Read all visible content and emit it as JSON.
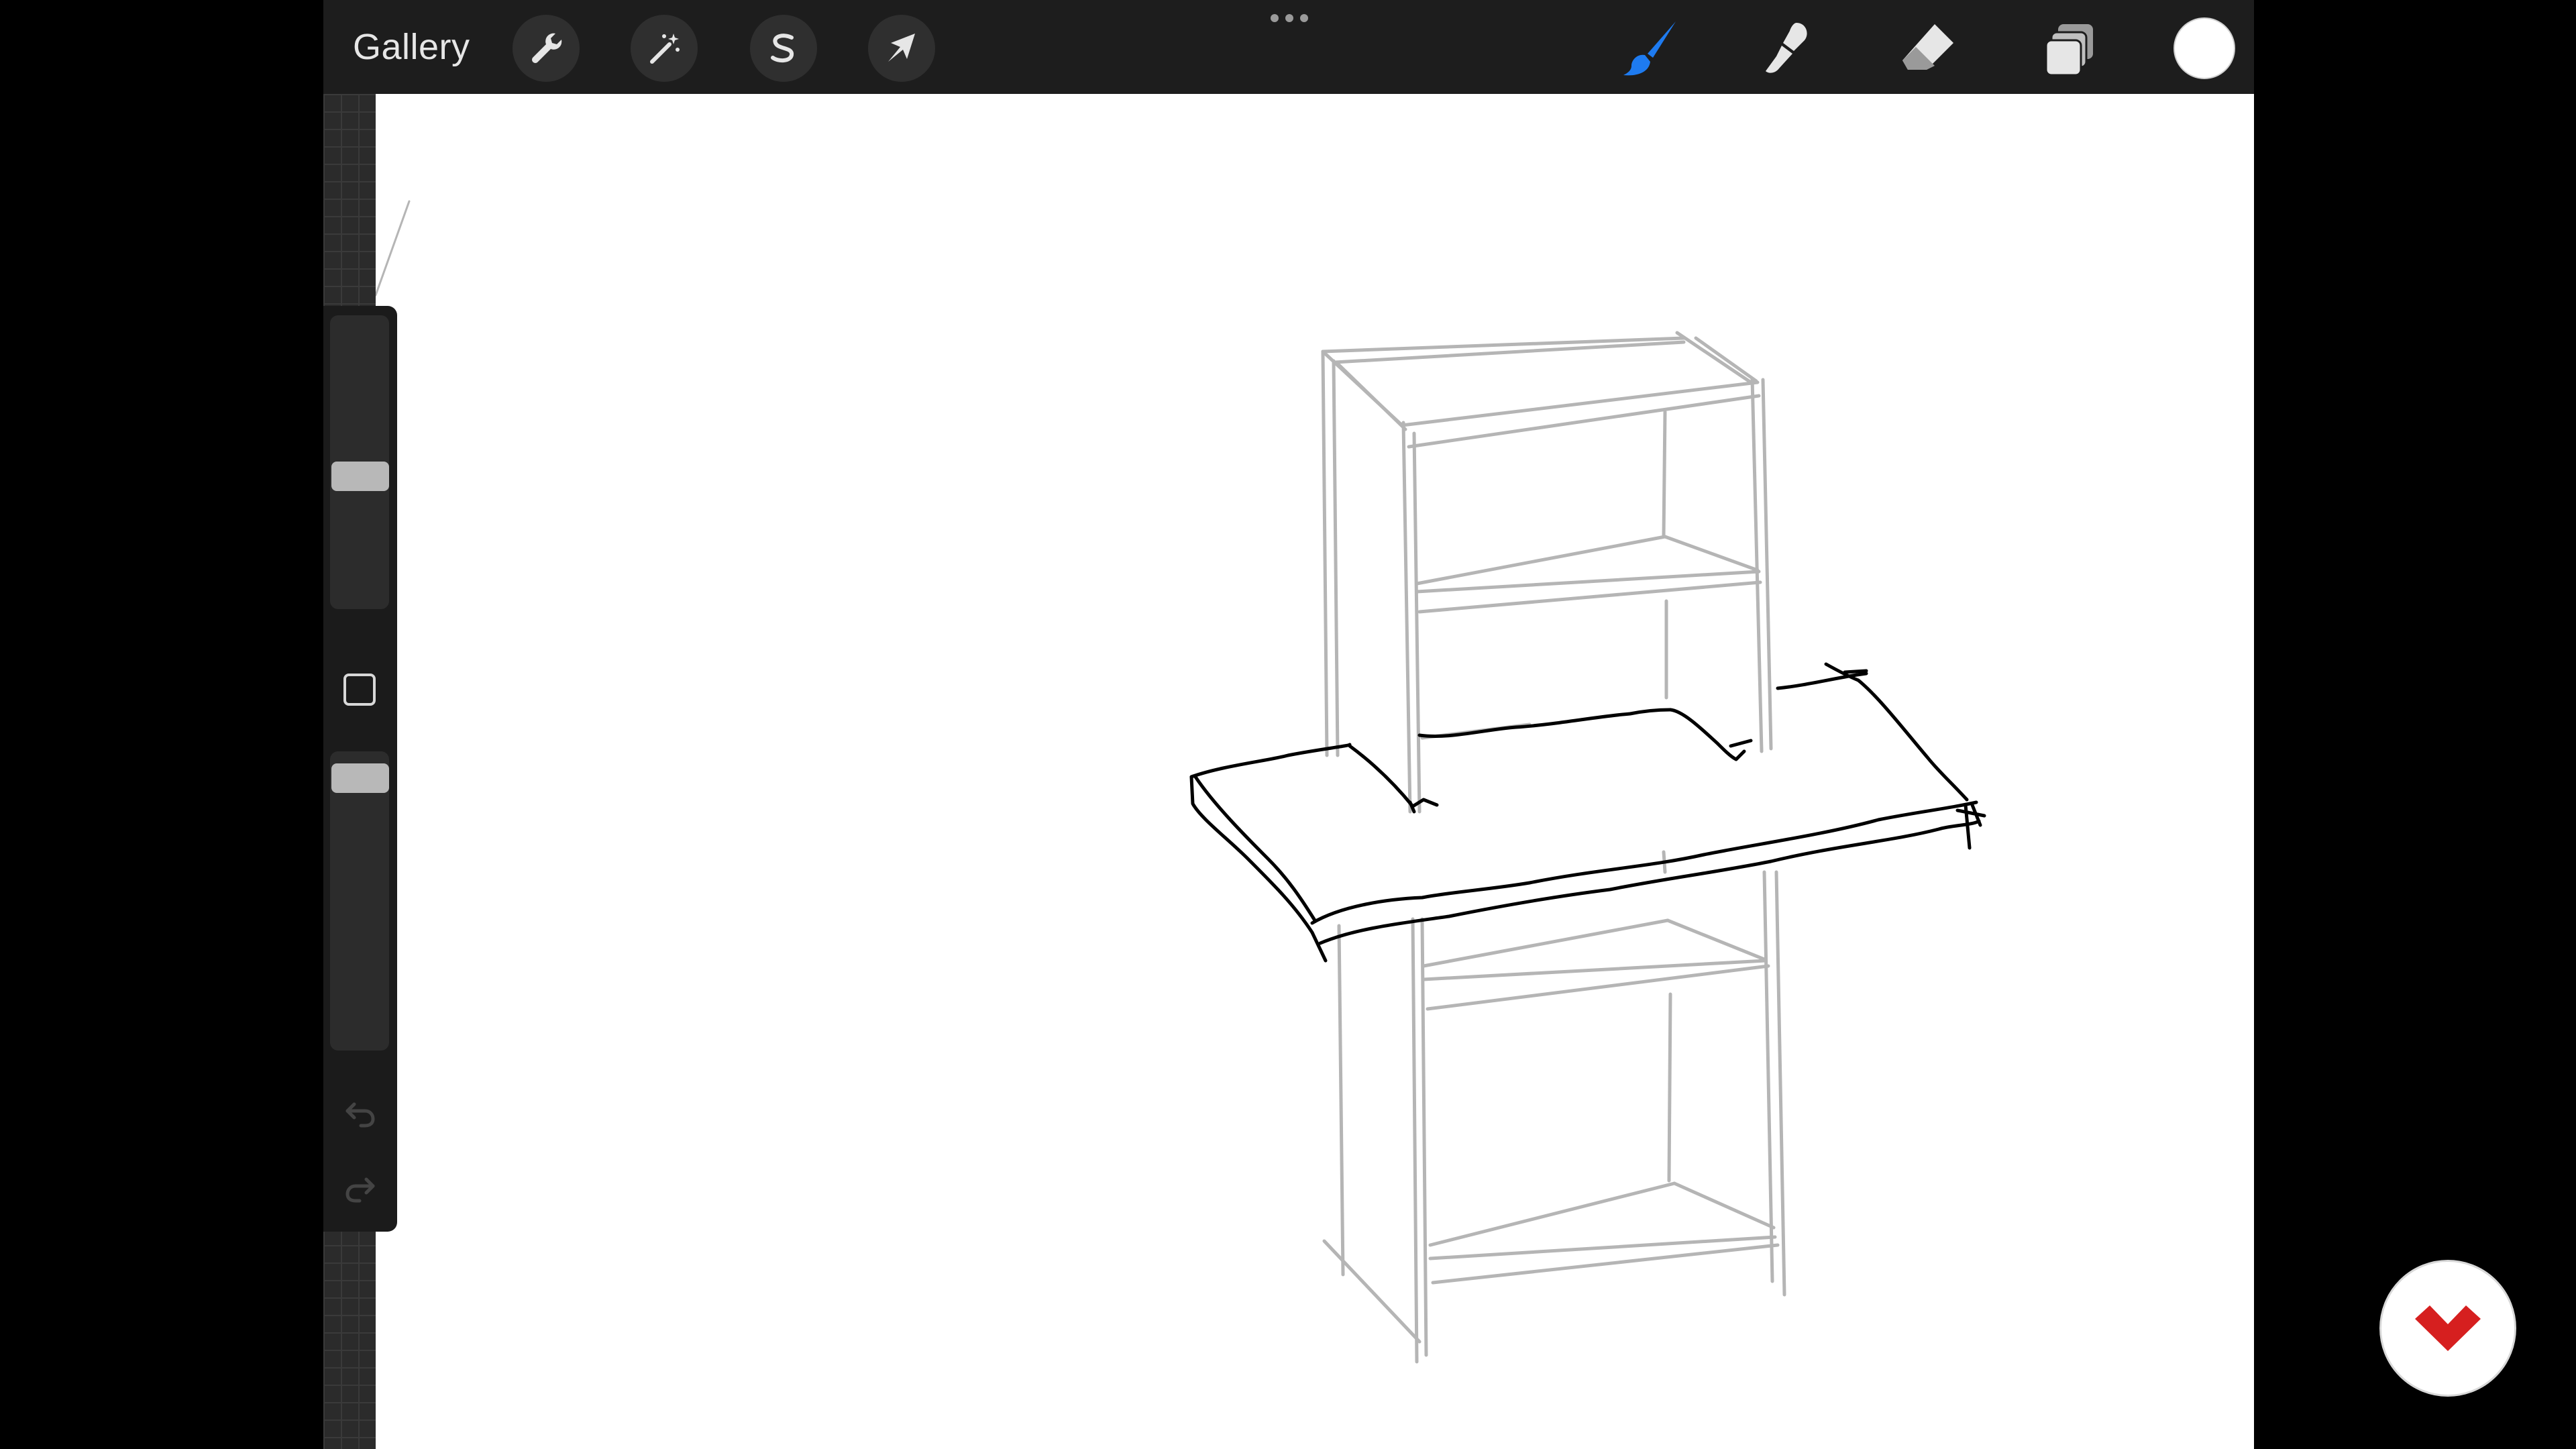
{
  "toolbar": {
    "gallery_label": "Gallery",
    "left_tools": [
      {
        "name": "actions",
        "icon": "wrench-icon"
      },
      {
        "name": "adjustments",
        "icon": "magic-wand-icon"
      },
      {
        "name": "selection",
        "icon": "selection-s-icon"
      },
      {
        "name": "transform",
        "icon": "arrow-cursor-icon"
      }
    ],
    "right_tools": [
      {
        "name": "brush",
        "icon": "brush-icon",
        "active": true
      },
      {
        "name": "smudge",
        "icon": "smudge-icon"
      },
      {
        "name": "eraser",
        "icon": "eraser-icon"
      },
      {
        "name": "layers",
        "icon": "layers-icon"
      }
    ],
    "current_color": "#ffffff",
    "active_tool_color": "#1e7bf0"
  },
  "sidebar": {
    "brush_size_level": 0.55,
    "opacity_level": 0.98
  },
  "canvas": {
    "background": "#ffffff",
    "sketch_color_guides": "#b5b5b5",
    "sketch_color_ink": "#000000"
  },
  "overlay": {
    "logo_icon": "chevron-logo-icon",
    "logo_color": "#d61f1f"
  }
}
